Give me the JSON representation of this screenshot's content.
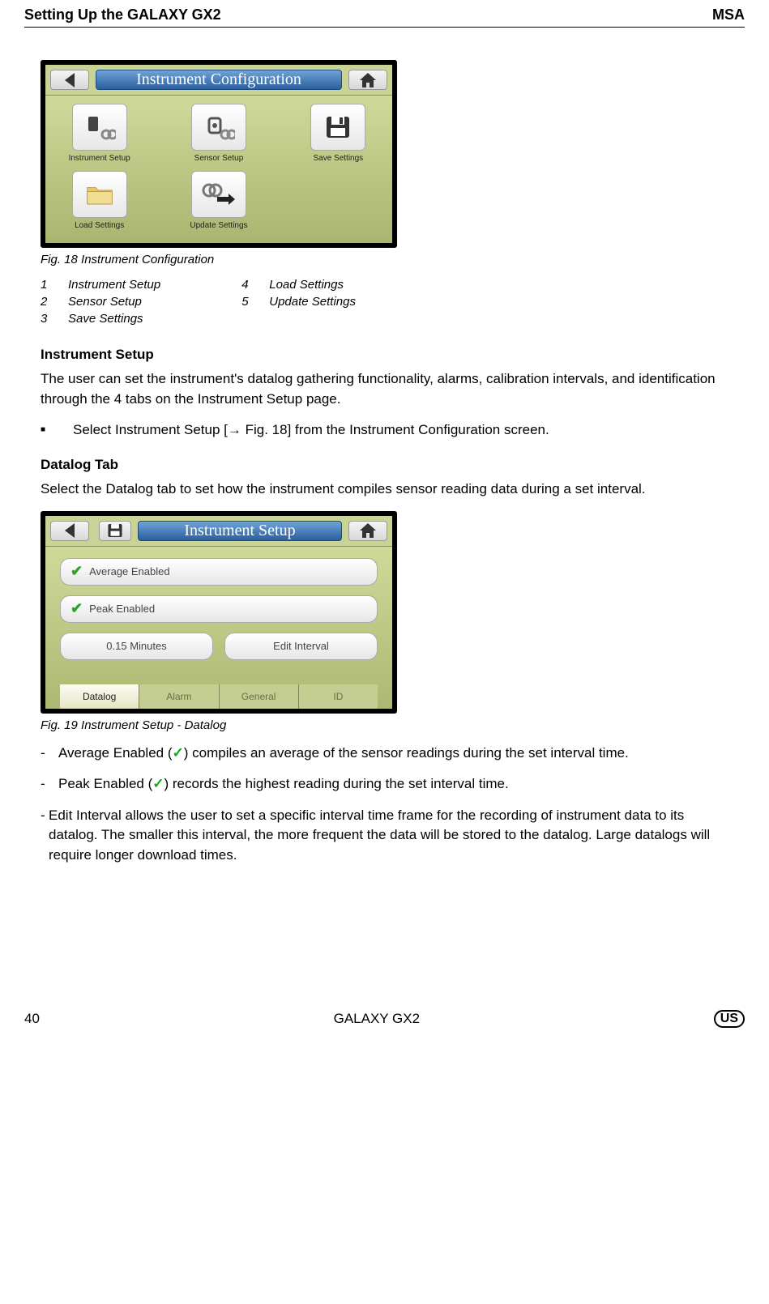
{
  "header": {
    "section": "Setting Up the GALAXY GX2",
    "brand": "MSA"
  },
  "fig18": {
    "title": "Instrument Configuration",
    "tiles": {
      "t1": "Instrument Setup",
      "t2": "Sensor Setup",
      "t3": "Save Settings",
      "t4": "Load Settings",
      "t5": "Update Settings"
    },
    "caption": "Fig. 18    Instrument Configuration",
    "legend": {
      "n1": "1",
      "l1": "Instrument Setup",
      "n2": "2",
      "l2": "Sensor Setup",
      "n3": "3",
      "l3": "Save Settings",
      "n4": "4",
      "l4": "Load Settings",
      "n5": "5",
      "l5": "Update Settings"
    }
  },
  "section1": {
    "heading": "Instrument Setup",
    "para": "The user can set the instrument's datalog gathering functionality, alarms, calibration intervals, and identification through the 4 tabs on the Instrument Setup page.",
    "bullet": "Select Instrument Setup [→ Fig. 18] from the Instrument Configuration screen."
  },
  "section2": {
    "heading": "Datalog Tab",
    "para": "Select the Datalog tab to set how the instrument compiles sensor reading data during a set interval."
  },
  "fig19": {
    "title": "Instrument Setup",
    "opt1": "Average Enabled",
    "opt2": "Peak Enabled",
    "interval_value": "0.15 Minutes",
    "edit": "Edit Interval",
    "tabs": {
      "t1": "Datalog",
      "t2": "Alarm",
      "t3": "General",
      "t4": "ID"
    },
    "caption": "Fig. 19    Instrument Setup - Datalog"
  },
  "dashes": {
    "d1a": "Average Enabled (",
    "d1b": ") compiles an average of the sensor readings during the set interval time.",
    "d2a": "Peak Enabled (",
    "d2b": ") records the highest reading during the set interval time.",
    "d3": "Edit Interval allows the user to set a specific interval time frame for the recording of instrument data to its datalog. The smaller this interval, the more frequent the data will be stored to the datalog. Large datalogs will require longer download times.",
    "check": "✓"
  },
  "footer": {
    "page": "40",
    "doc": "GALAXY GX2",
    "region": "US"
  }
}
